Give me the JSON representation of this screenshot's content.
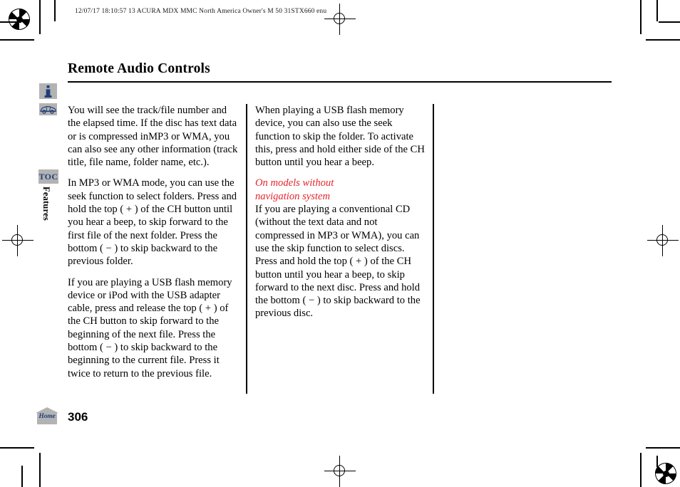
{
  "print_slug": "12/07/17 18:10:57   13 ACURA MDX MMC North America Owner's M 50 31STX660 enu",
  "header": {
    "title": "Remote Audio Controls"
  },
  "sidebar": {
    "info_icon_label": "i",
    "vehicle_icon_label": "car",
    "toc_label": "TOC",
    "chapter_label": "Features"
  },
  "content": {
    "left_column": [
      "You will see the track/file number and the elapsed time. If the disc has text data or is compressed inMP3 or WMA, you can also see any other information (track title, file name, folder name, etc.).",
      "In MP3 or WMA mode, you can use the seek function to select folders. Press and hold the top ( + ) of the CH button until you hear a beep, to skip forward to the first file of the next folder. Press the bottom ( − ) to skip backward to the previous folder.",
      "If you are playing a USB flash memory device or iPod with the USB adapter cable, press and release the top ( + ) of the CH button to skip forward to the beginning of the next file. Press the bottom ( − ) to skip backward to the beginning to the current file. Press it twice to return to the previous file."
    ],
    "right_column": {
      "intro": "When playing a USB flash memory device, you can also use the seek function to skip the folder. To activate this, press and hold either side of the CH button until you hear a beep.",
      "subhead_line1": "On models without",
      "subhead_line2": "navigation system",
      "body": "If you are playing a conventional CD (without the text data and not compressed in MP3 or WMA), you can use the skip function to select discs. Press and hold the top ( + ) of the CH button until you hear a beep, to skip forward to the next disc. Press and hold the bottom ( − ) to skip backward to the previous disc."
    }
  },
  "footer": {
    "home_label": "Home",
    "page_number": "306"
  },
  "colors": {
    "subhead_red": "#e8222a",
    "icon_blue": "#1f3f7a",
    "icon_gray": "#b3b3b3"
  }
}
